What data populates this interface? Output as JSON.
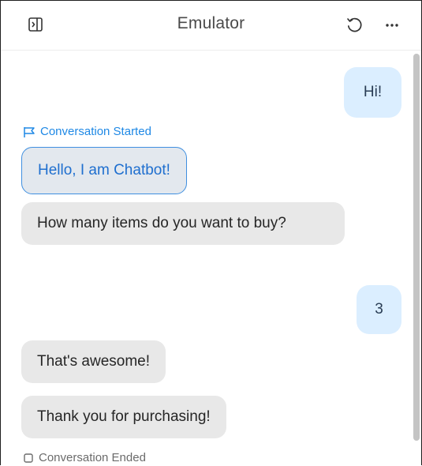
{
  "header": {
    "title": "Emulator",
    "icons": {
      "panel": "panel-toggle-icon",
      "reset": "reset-icon",
      "more": "more-icon"
    }
  },
  "conversation": {
    "started_label": "Conversation Started",
    "ended_label": "Conversation Ended",
    "messages": [
      {
        "sender": "user",
        "text": "Hi!"
      },
      {
        "sender": "bot",
        "text": "Hello, I am Chatbot!"
      },
      {
        "sender": "bot",
        "text": "How many items do you want to buy?"
      },
      {
        "sender": "user",
        "text": "3"
      },
      {
        "sender": "bot",
        "text": "That's awesome!"
      },
      {
        "sender": "bot",
        "text": "Thank you for purchasing!"
      }
    ]
  },
  "colors": {
    "accent": "#1e88e5",
    "user_bubble": "#dbeeff",
    "bot_bubble": "#e8e8e8",
    "highlight_border": "#3f8fe0"
  }
}
